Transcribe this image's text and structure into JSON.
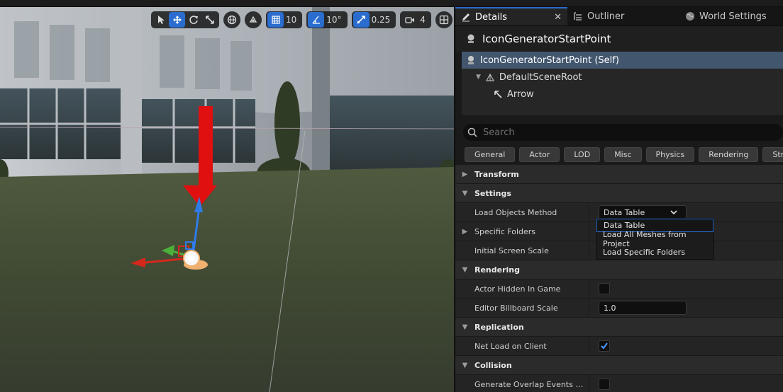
{
  "viewport": {
    "toolbar": {
      "grid_snap_value": "10",
      "rotation_snap_value": "10°",
      "scale_snap_value": "0.25",
      "camera_speed_value": "4"
    }
  },
  "panel": {
    "tabs": [
      {
        "label": "Details",
        "icon": "pencil-icon",
        "active": true
      },
      {
        "label": "Outliner",
        "icon": "list-icon",
        "active": false
      },
      {
        "label": "World Settings",
        "icon": "globe-icon",
        "active": false
      }
    ],
    "close_glyph": "✕",
    "actor_name": "IconGeneratorStartPoint",
    "components": [
      {
        "label": "IconGeneratorStartPoint (Self)",
        "selected": true
      },
      {
        "label": "DefaultSceneRoot",
        "selected": false
      },
      {
        "label": "Arrow",
        "selected": false
      }
    ],
    "search_placeholder": "Search",
    "filters": [
      "General",
      "Actor",
      "LOD",
      "Misc",
      "Physics",
      "Rendering",
      "Stre"
    ],
    "categories": {
      "transform": "Transform",
      "settings": "Settings",
      "rendering": "Rendering",
      "replication": "Replication",
      "collision": "Collision"
    },
    "properties": {
      "load_objects_method": {
        "label": "Load Objects Method",
        "value": "Data Table"
      },
      "specific_folders": {
        "label": "Specific Folders"
      },
      "initial_screen_scale": {
        "label": "Initial Screen Scale"
      },
      "actor_hidden_in_game": {
        "label": "Actor Hidden In Game",
        "checked": false
      },
      "editor_billboard_scale": {
        "label": "Editor Billboard Scale",
        "value": "1.0"
      },
      "net_load_on_client": {
        "label": "Net Load on Client",
        "checked": true
      },
      "generate_overlap_events": {
        "label": "Generate Overlap Events Duri...",
        "checked": false
      }
    },
    "dropdown_options": [
      "Data Table",
      "Load All Meshes from Project",
      "Load Specific Folders"
    ]
  },
  "colors": {
    "accent": "#2a6dcf",
    "selection": "#42566e",
    "gizmo_x": "#d4281d",
    "gizmo_z": "#2f7be8",
    "gizmo_y": "#4caf3a",
    "arrow_component": "#e01010"
  }
}
